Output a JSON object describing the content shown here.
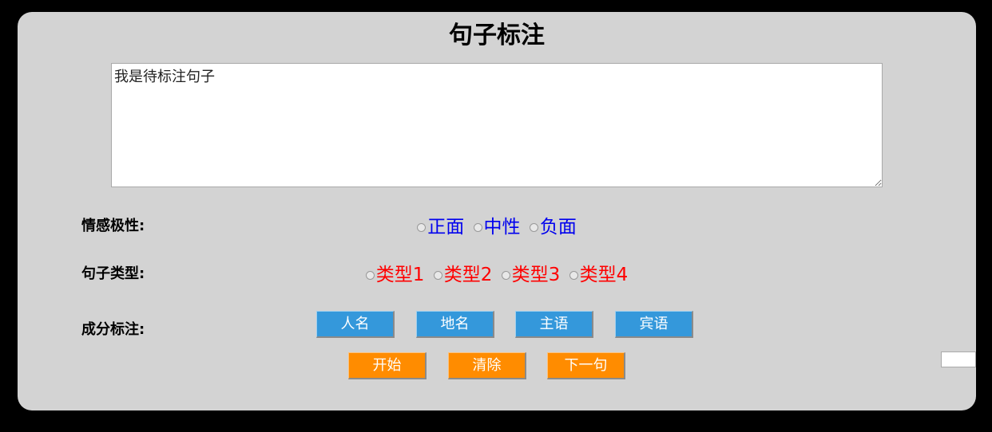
{
  "title": "句子标注",
  "sentence": {
    "value": "我是待标注句子"
  },
  "sentiment": {
    "label": "情感极性:",
    "options": [
      "正面",
      "中性",
      "负面"
    ]
  },
  "sentence_type": {
    "label": "句子类型:",
    "options": [
      "类型1",
      "类型2",
      "类型3",
      "类型4"
    ]
  },
  "component": {
    "label": "成分标注:",
    "buttons": [
      "人名",
      "地名",
      "主语",
      "宾语"
    ]
  },
  "actions": {
    "start": "开始",
    "clear": "清除",
    "next": "下一句"
  },
  "side_input": {
    "value": ""
  },
  "colors": {
    "background": "#d3d3d3",
    "blue_button": "#3498db",
    "orange_button": "#ff8c00",
    "sentiment_text": "#0000ee",
    "type_text": "#ff0000"
  }
}
